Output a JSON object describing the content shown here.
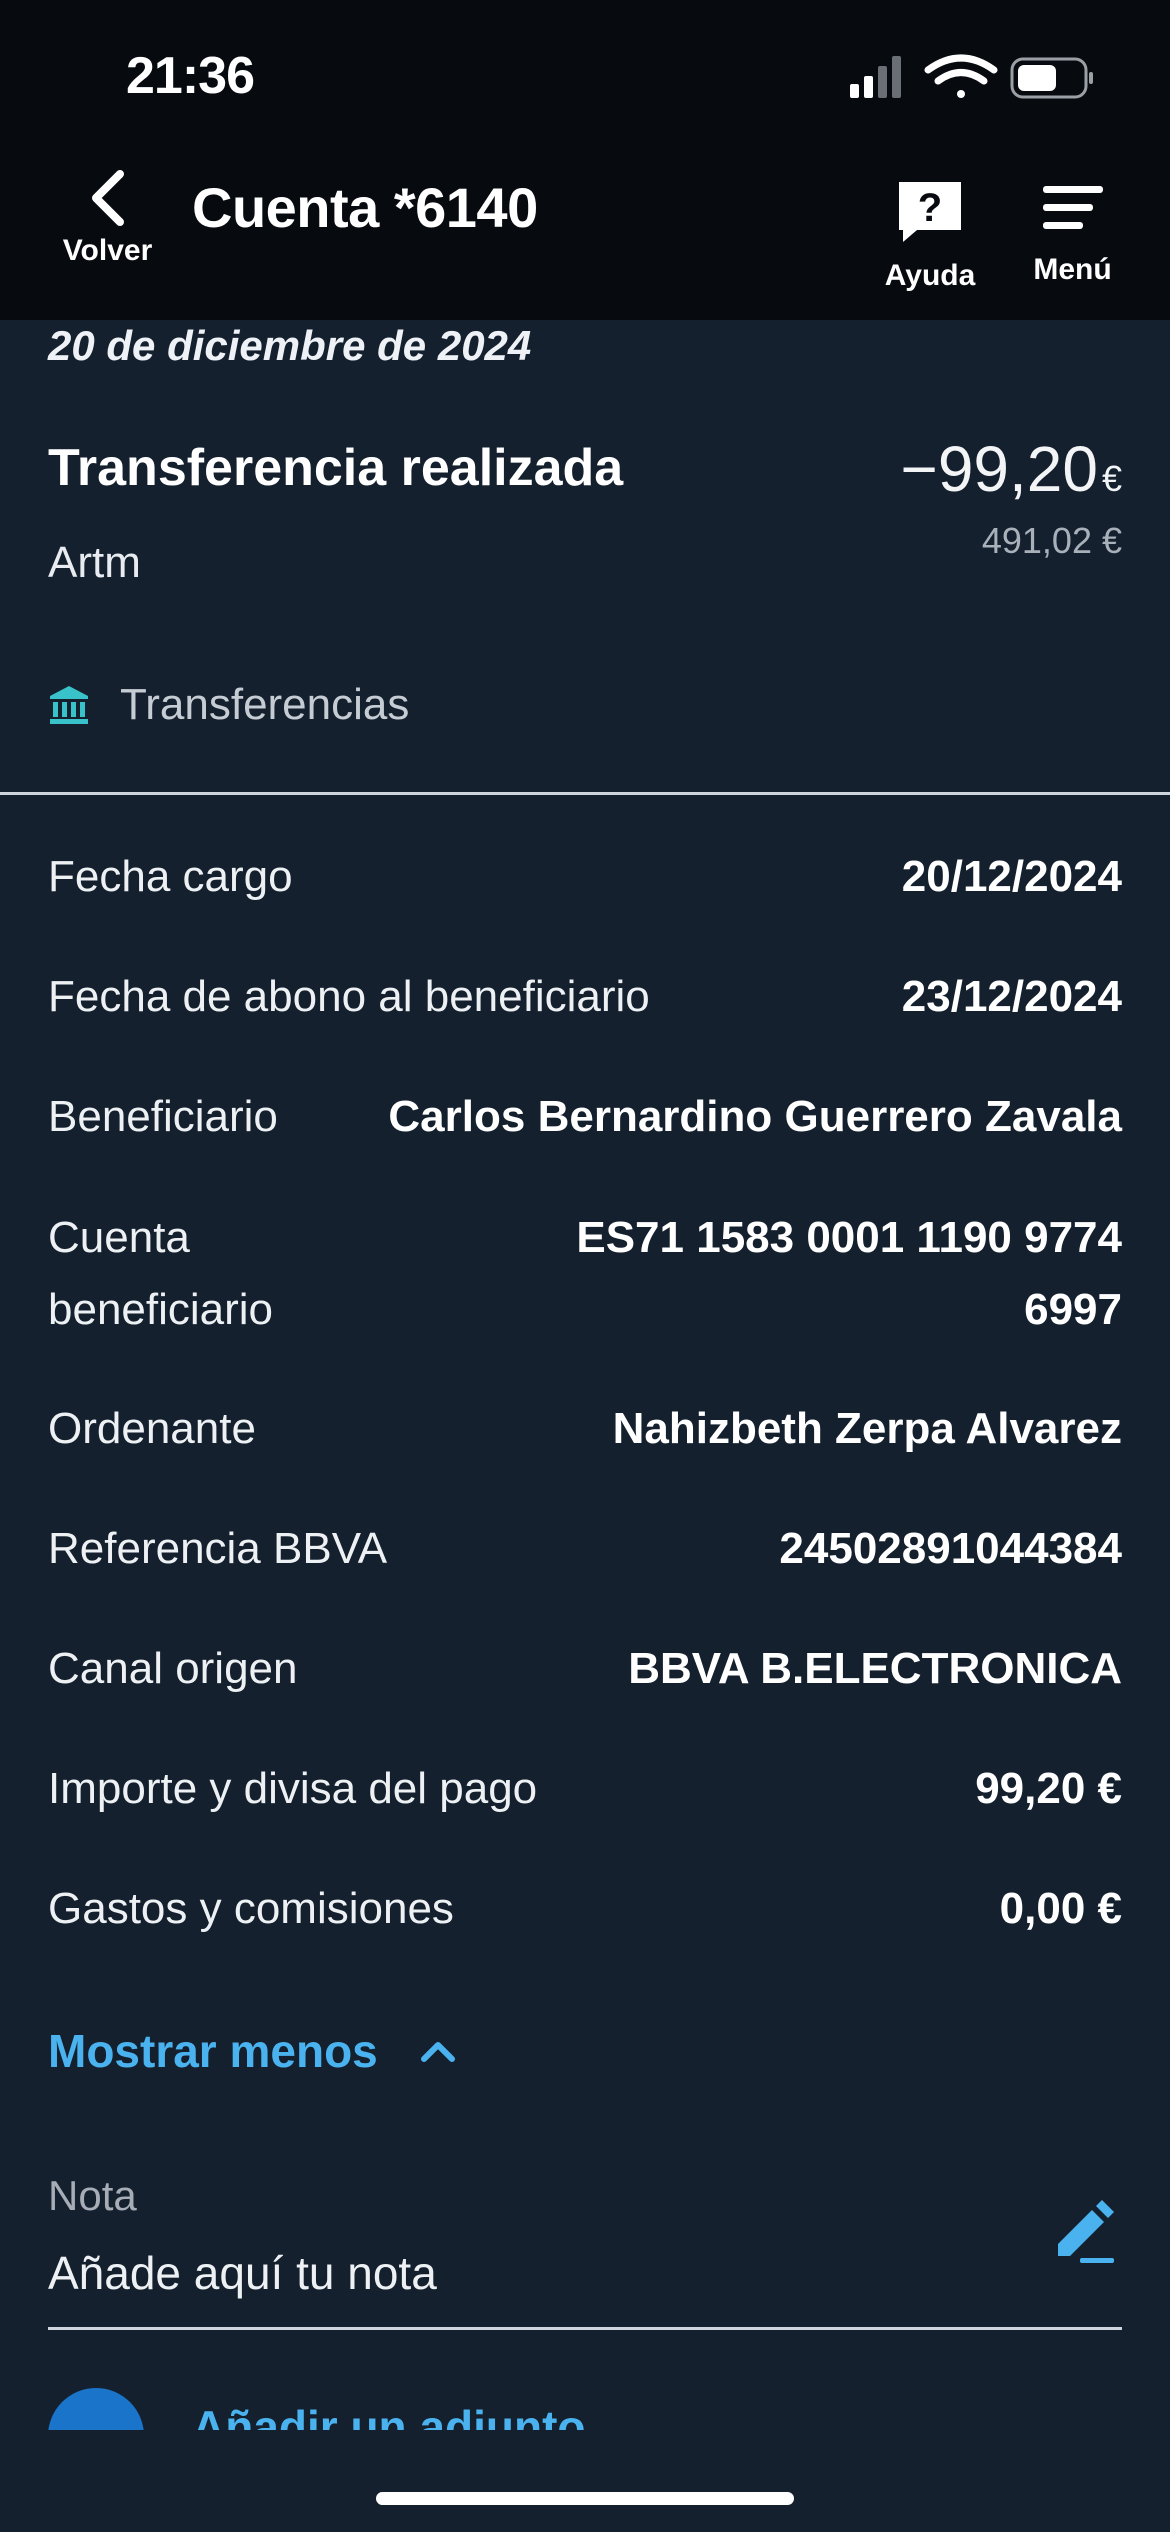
{
  "status_bar": {
    "time": "21:36",
    "icons": [
      "cellular-signal-icon",
      "wifi-icon",
      "battery-icon"
    ]
  },
  "header": {
    "back_label": "Volver",
    "title": "Cuenta *6140",
    "help_label": "Ayuda",
    "menu_label": "Menú"
  },
  "transaction": {
    "date": "20 de diciembre de 2024",
    "title": "Transferencia realizada",
    "subtitle": "Artm",
    "amount": "−99,20",
    "amount_currency": "€",
    "balance": "491,02 €",
    "category": "Transferencias",
    "category_icon": "bank-icon",
    "category_color": "#39c2c9"
  },
  "details": [
    {
      "label": "Fecha cargo",
      "value": "20/12/2024"
    },
    {
      "label": "Fecha de abono al beneficiario",
      "value": "23/12/2024"
    },
    {
      "label": "Beneficiario",
      "value": "Carlos Bernardino Guerrero Zavala"
    },
    {
      "label": "Cuenta beneficiario",
      "value": "ES71 1583 0001 1190 9774 6997"
    },
    {
      "label": "Ordenante",
      "value": "Nahizbeth Zerpa Alvarez"
    },
    {
      "label": "Referencia BBVA",
      "value": "24502891044384"
    },
    {
      "label": "Canal origen",
      "value": "BBVA B.ELECTRONICA"
    },
    {
      "label": "Importe y divisa del pago",
      "value": "99,20 €"
    },
    {
      "label": "Gastos y comisiones",
      "value": "0,00 €"
    }
  ],
  "toggle_label": "Mostrar menos",
  "note": {
    "label": "Nota",
    "placeholder": "Añade aquí tu nota"
  },
  "partial_action": "Añadir un adjunto",
  "colors": {
    "background": "#14202e",
    "header_bg": "#070b10",
    "accent": "#4ab3ef"
  }
}
